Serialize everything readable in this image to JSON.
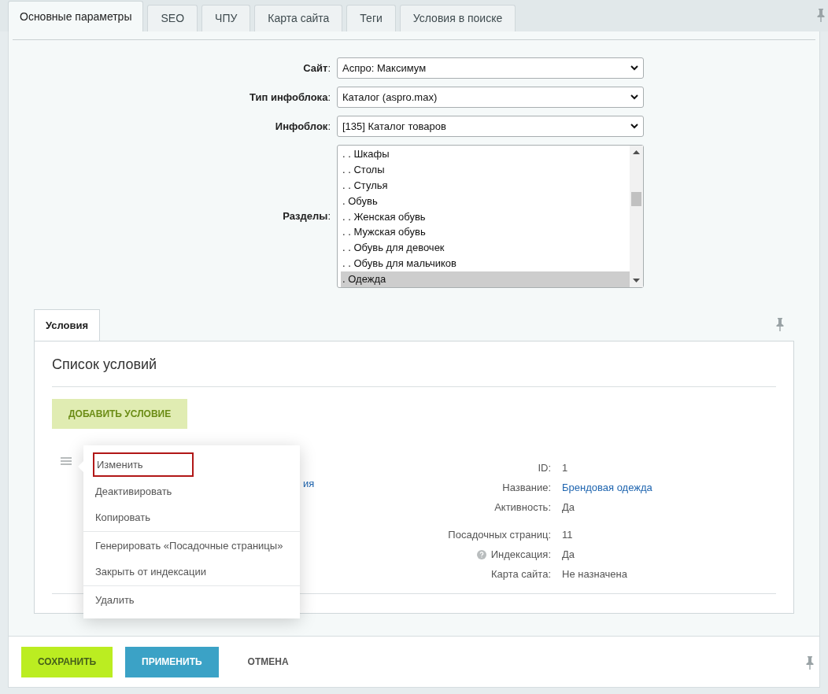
{
  "tabs": [
    {
      "label": "Основные параметры",
      "selected": true
    },
    {
      "label": "SEO",
      "selected": false
    },
    {
      "label": "ЧПУ",
      "selected": false
    },
    {
      "label": "Карта сайта",
      "selected": false
    },
    {
      "label": "Теги",
      "selected": false
    },
    {
      "label": "Условия в поиске",
      "selected": false
    }
  ],
  "form": {
    "fields": [
      {
        "label": "**Сайт**:",
        "value": "Аспро: Максимум"
      },
      {
        "label": "**Тип инфоблока**:",
        "value": "Каталог (aspro.max)"
      },
      {
        "label": "**Инфоблок**:",
        "value": "[135] Каталог товаров"
      }
    ],
    "sections": {
      "label": "**Разделы**:",
      "items": [
        {
          "text": ". . Шкафы",
          "selected": false
        },
        {
          "text": ". . Столы",
          "selected": false
        },
        {
          "text": ". . Стулья",
          "selected": false
        },
        {
          "text": ". Обувь",
          "selected": false
        },
        {
          "text": ". . Женская обувь",
          "selected": false
        },
        {
          "text": ". . Мужская обувь",
          "selected": false
        },
        {
          "text": ". . Обувь для девочек",
          "selected": false
        },
        {
          "text": ". . Обувь для мальчиков",
          "selected": false
        },
        {
          "text": ". Одежда",
          "selected": true
        }
      ]
    }
  },
  "conditions": {
    "tab": {
      "label": "Условия",
      "selected": true
    },
    "title": "Список условий",
    "add_button": "ДОБАВИТЬ УСЛОВИЕ",
    "hidden_fragment": "ия",
    "details": [
      {
        "label": "ID:",
        "value": "1",
        "kind": "text"
      },
      {
        "label": "Название:",
        "value": "Брендовая одежда",
        "kind": "link"
      },
      {
        "label": "Активность:",
        "value": "Да",
        "kind": "text"
      },
      {
        "label": "Посадочных страниц:",
        "value": "11",
        "kind": "text",
        "gap": true
      },
      {
        "label": "Индексация:",
        "value": "Да",
        "kind": "help"
      },
      {
        "label": "Карта сайта:",
        "value": "Не назначена",
        "kind": "text"
      }
    ],
    "menu": [
      {
        "label": "Изменить",
        "focused": true,
        "divider_before": false
      },
      {
        "label": "Деактивировать",
        "focused": false,
        "divider_before": false
      },
      {
        "label": "Копировать",
        "focused": false,
        "divider_before": false
      },
      {
        "label": "Генерировать «Посадочные страницы»",
        "focused": false,
        "divider_before": true
      },
      {
        "label": "Закрыть от индексации",
        "focused": false,
        "divider_before": false
      },
      {
        "label": "Удалить",
        "focused": false,
        "divider_before": true
      }
    ]
  },
  "footer": {
    "buttons": [
      {
        "label": "СОХРАНИТЬ",
        "kind": "save"
      },
      {
        "label": "ПРИМЕНИТЬ",
        "kind": "apply"
      },
      {
        "label": "ОТМЕНА",
        "kind": "cancel"
      }
    ]
  }
}
